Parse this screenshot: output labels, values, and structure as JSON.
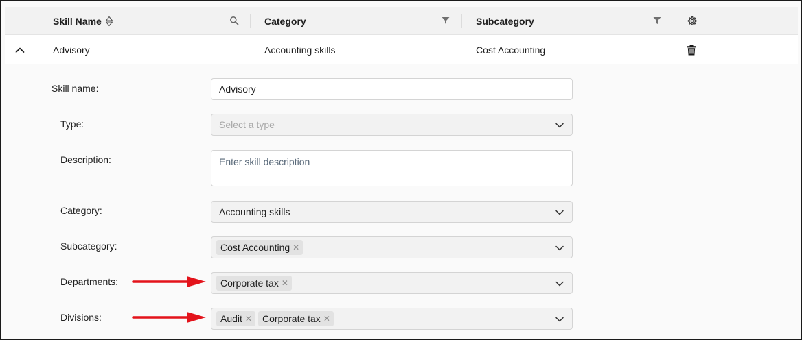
{
  "table": {
    "headers": {
      "skill_name": "Skill Name",
      "category": "Category",
      "subcategory": "Subcategory"
    },
    "row": {
      "skill_name": "Advisory",
      "category": "Accounting skills",
      "subcategory": "Cost Accounting"
    }
  },
  "form": {
    "skill_name": {
      "label": "Skill name",
      "value": "Advisory"
    },
    "type": {
      "label": "Type",
      "placeholder": "Select a type"
    },
    "description": {
      "label": "Description",
      "placeholder": "Enter skill description"
    },
    "category": {
      "label": "Category",
      "value": "Accounting skills"
    },
    "subcategory": {
      "label": "Subcategory",
      "tags": [
        "Cost Accounting"
      ]
    },
    "departments": {
      "label": "Departments",
      "tags": [
        "Corporate tax"
      ]
    },
    "divisions": {
      "label": "Divisions",
      "tags": [
        "Audit",
        "Corporate tax"
      ]
    }
  },
  "label_suffix": ":",
  "colors": {
    "arrow": "#e3131b",
    "header_bg": "#f2f2f2",
    "field_bg": "#f2f2f2"
  },
  "icons": [
    "sort-icon",
    "search-icon",
    "filter-icon",
    "settings-icon",
    "collapse-icon",
    "trash-icon",
    "chevron-down-icon",
    "remove-tag-icon",
    "annotation-arrow"
  ]
}
